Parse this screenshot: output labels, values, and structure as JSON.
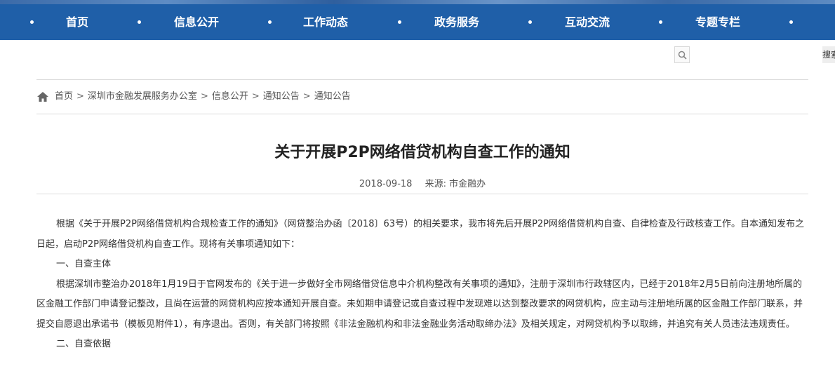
{
  "nav": {
    "items": [
      {
        "label": "首页"
      },
      {
        "label": "信息公开"
      },
      {
        "label": "工作动态"
      },
      {
        "label": "政务服务"
      },
      {
        "label": "互动交流"
      },
      {
        "label": "专题专栏"
      }
    ]
  },
  "search": {
    "icon": "search-icon",
    "side_label": "搜索"
  },
  "breadcrumb": {
    "items": [
      "首页",
      "深圳市金融发展服务办公室",
      "信息公开",
      "通知公告",
      "通知公告"
    ],
    "separator": ">"
  },
  "article": {
    "title": "关于开展P2P网络借贷机构自查工作的通知",
    "date": "2018-09-18",
    "source": "来源: 市金融办",
    "paragraphs": [
      "根据《关于开展P2P网络借贷机构合规检查工作的通知》（网贷整治办函〔2018〕63号）的相关要求，我市将先后开展P2P网络借贷机构自查、自律检查及行政核查工作。自本通知发布之日起，启动P2P网络借贷机构自查工作。现将有关事项通知如下：",
      "一、自查主体",
      "根据深圳市整治办2018年1月19日于官网发布的《关于进一步做好全市网络借贷信息中介机构整改有关事项的通知》，注册于深圳市行政辖区内，已经于2018年2月5日前向注册地所属的区金融工作部门申请登记整改，且尚在运营的网贷机构应按本通知开展自查。未如期申请登记或自查过程中发现难以达到整改要求的网贷机构，应主动与注册地所属的区金融工作部门联系，并提交自愿退出承诺书（模板见附件1），有序退出。否则，有关部门将按照《非法金融机构和非法金融业务活动取缔办法》及相关规定，对网贷机构予以取缔，并追究有关人员违法违规责任。",
      "二、自查依据"
    ]
  },
  "colors": {
    "nav_bg": "#1f5fa8",
    "nav_text": "#ffffff"
  }
}
